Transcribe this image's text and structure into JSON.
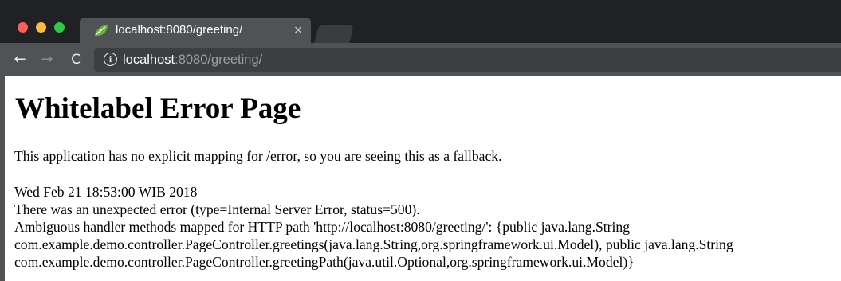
{
  "browser": {
    "tab": {
      "title": "localhost:8080/greeting/",
      "favicon": "spring-leaf-icon",
      "close_glyph": "×"
    },
    "toolbar": {
      "back_glyph": "←",
      "forward_glyph": "→",
      "reload_glyph": "C",
      "info_glyph": "i"
    },
    "url": {
      "host": "localhost",
      "rest": ":8080/greeting/"
    }
  },
  "page": {
    "title": "Whitelabel Error Page",
    "intro": "This application has no explicit mapping for /error, so you are seeing this as a fallback.",
    "timestamp": "Wed Feb 21 18:53:00 WIB 2018",
    "error_type": "There was an unexpected error (type=Internal Server Error, status=500).",
    "detail_lines": [
      "Ambiguous handler methods mapped for HTTP path 'http://localhost:8080/greeting/': {public java.lang.String",
      "com.example.demo.controller.PageController.greetings(java.lang.String,org.springframework.ui.Model), public java.lang.String",
      "com.example.demo.controller.PageController.greetingPath(java.util.Optional,org.springframework.ui.Model)}"
    ]
  },
  "colors": {
    "titlebar": "#202124",
    "toolbar": "#505356",
    "close": "#fc605c",
    "minimize": "#fdbc40",
    "maximize": "#34c84a",
    "spring_green": "#6db33f"
  }
}
